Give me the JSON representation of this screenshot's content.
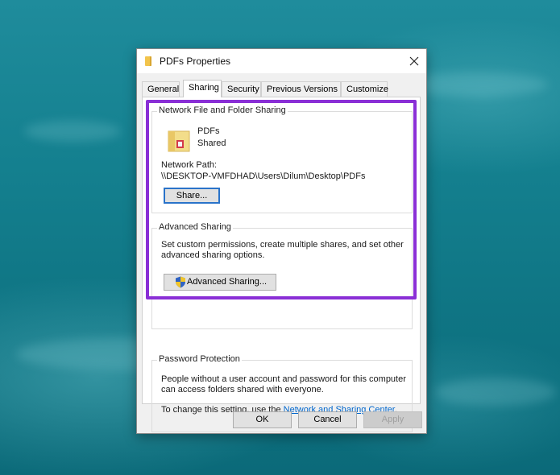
{
  "window": {
    "title": "PDFs Properties",
    "close_glyph": "✕"
  },
  "tabs": [
    {
      "label": "General"
    },
    {
      "label": "Sharing"
    },
    {
      "label": "Security"
    },
    {
      "label": "Previous Versions"
    },
    {
      "label": "Customize"
    }
  ],
  "active_tab": "Sharing",
  "network_sharing": {
    "legend": "Network File and Folder Sharing",
    "folder_name": "PDFs",
    "status": "Shared",
    "path_label": "Network Path:",
    "path_value": "\\\\DESKTOP-VMFDHAD\\Users\\Dilum\\Desktop\\PDFs",
    "share_button": "Share..."
  },
  "advanced_sharing": {
    "legend": "Advanced Sharing",
    "description_line1": "Set custom permissions, create multiple shares, and set other",
    "description_line2": "advanced sharing options.",
    "button": "Advanced Sharing..."
  },
  "password_protection": {
    "legend": "Password Protection",
    "line1": "People without a user account and password for this computer",
    "line2": "can access folders shared with everyone.",
    "change_prefix": "To change this setting, use the ",
    "link_text": "Network and Sharing Center",
    "change_suffix": "."
  },
  "footer": {
    "ok": "OK",
    "cancel": "Cancel",
    "apply": "Apply"
  },
  "icons": {
    "title": "folder-icon",
    "close": "close-icon",
    "shared_folder": "shared-folder-icon",
    "uac_shield": "uac-shield-icon"
  },
  "colors": {
    "highlight": "#8a2fd6",
    "link": "#0066cc",
    "default_button_border": "#2a73c9",
    "wallpaper": "#14808f"
  }
}
